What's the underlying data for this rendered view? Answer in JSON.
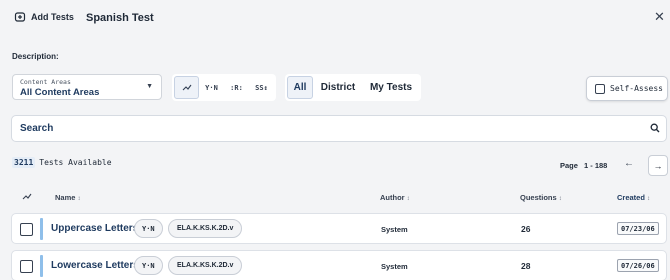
{
  "header": {
    "add_tests_label": "Add Tests",
    "title": "Spanish Test",
    "close_glyph": "✕"
  },
  "description_label": "Description:",
  "content_areas": {
    "label": "Content Areas",
    "value": "All Content Areas"
  },
  "view_toggles": [
    {
      "icon": "chart-icon",
      "label": "",
      "active": true
    },
    {
      "icon": "yes-no-icon",
      "label": "Y·N",
      "active": false
    },
    {
      "icon": "bracket-icon",
      "label": ":R:",
      "active": false
    },
    {
      "icon": "sort-icon",
      "label": "SS↕",
      "active": false
    }
  ],
  "filter_tabs": [
    {
      "label": "All",
      "active": true
    },
    {
      "label": "District",
      "active": false
    },
    {
      "label": "My Tests",
      "active": false
    }
  ],
  "self_assess": {
    "label": "Self-Assess",
    "checked": false
  },
  "search": {
    "placeholder": "Search"
  },
  "results": {
    "count": "3211",
    "suffix": "Tests Available"
  },
  "pagination": {
    "page_label": "Page",
    "range": "1 - 188",
    "prev_glyph": "←",
    "next_glyph": "→"
  },
  "table": {
    "columns": {
      "name": "Name",
      "author": "Author",
      "questions": "Questions",
      "created": "Created"
    },
    "rows": [
      {
        "name": "Uppercase Letters",
        "type_badge": "Y·N",
        "standard": "ELA.K.KS.K.2D.v",
        "author": "System",
        "questions": "26",
        "created": "07/23/06"
      },
      {
        "name": "Lowercase Letters",
        "type_badge": "Y·N",
        "standard": "ELA.K.KS.K.2D.v",
        "author": "System",
        "questions": "28",
        "created": "07/26/06"
      }
    ]
  },
  "colors": {
    "accent": "#1e3a5f",
    "row_marker": "#8fbfea",
    "background": "#f3f4f6"
  }
}
